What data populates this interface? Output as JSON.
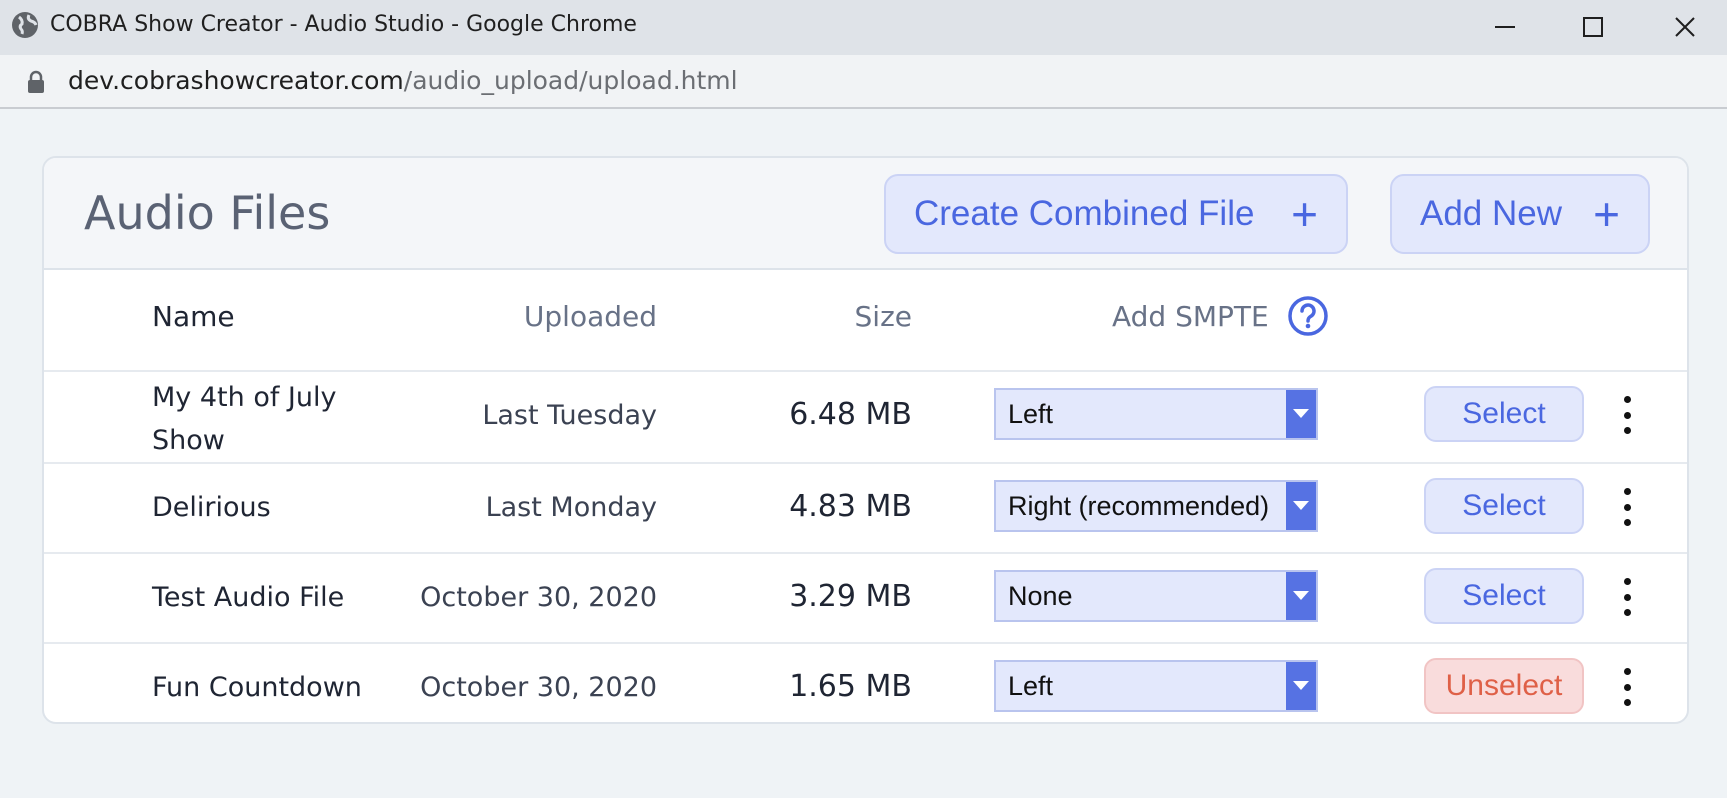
{
  "window": {
    "title": "COBRA Show Creator - Audio Studio - Google Chrome",
    "url_host": "dev.cobrashowcreator.com",
    "url_path": "/audio_upload/upload.html"
  },
  "card": {
    "title": "Audio Files",
    "create_combined_label": "Create Combined File",
    "add_new_label": "Add New",
    "plus": "+"
  },
  "table": {
    "headers": {
      "name": "Name",
      "uploaded": "Uploaded",
      "size": "Size",
      "smpte": "Add SMPTE"
    },
    "rows": [
      {
        "name_line1": "My 4th of July",
        "name_line2": "Show",
        "uploaded": "Last Tuesday",
        "size": "6.48 MB",
        "smpte": "Left",
        "action": "Select"
      },
      {
        "name_line1": "Delirious",
        "name_line2": "",
        "uploaded": "Last Monday",
        "size": "4.83 MB",
        "smpte": "Right (recommended)",
        "action": "Select"
      },
      {
        "name_line1": "Test Audio File",
        "name_line2": "",
        "uploaded": "October 30, 2020",
        "size": "3.29 MB",
        "smpte": "None",
        "action": "Select"
      },
      {
        "name_line1": "Fun Countdown",
        "name_line2": "",
        "uploaded": "October 30, 2020",
        "size": "1.65 MB",
        "smpte": "Left",
        "action": "Unselect"
      }
    ]
  },
  "colors": {
    "accent": "#4a67e0",
    "dropdown_arrow_bg": "#5672e3",
    "unselect_text": "#df6047",
    "unselect_bg": "#f9dcdc"
  },
  "icons": [
    "globe-icon",
    "minimize-icon",
    "maximize-icon",
    "close-icon",
    "lock-icon",
    "plus-icon",
    "help-icon",
    "chevron-down-icon",
    "more-vertical-icon"
  ]
}
